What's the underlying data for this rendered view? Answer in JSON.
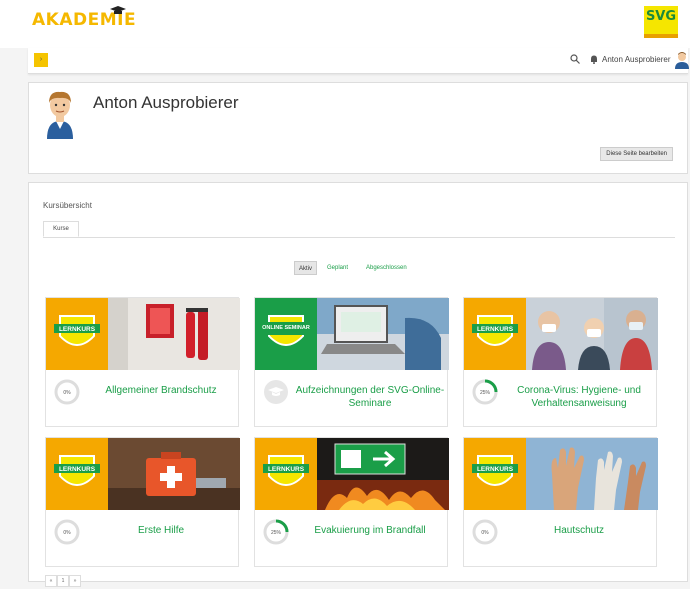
{
  "brand": {
    "left_logo": "AKADEMIE",
    "right_logo": "SVG",
    "colors": {
      "yellow": "#f5b800",
      "green": "#1a9e48"
    }
  },
  "navbar": {
    "toggle_icon": "hamburger-icon",
    "user_name": "Anton Ausprobierer",
    "icons": [
      "search-icon",
      "bell-icon",
      "avatar-icon",
      "caret-down-icon"
    ]
  },
  "profile": {
    "name": "Anton Ausprobierer",
    "edit_button": "Diese Seite bearbeiten"
  },
  "overview": {
    "title": "Kursübersicht",
    "tab": "Kurse",
    "filters": [
      "Aktiv",
      "Geplant",
      "Abgeschlossen"
    ],
    "active_filter": "Aktiv",
    "courses": [
      {
        "title": "Allgemeiner Brandschutz",
        "progress": 0,
        "progress_label": "0%",
        "badge": "LERNKURS"
      },
      {
        "title": "Aufzeichnungen der SVG-Online-Seminare",
        "progress": null,
        "progress_label": "",
        "badge": "ONLINE SEMINAR"
      },
      {
        "title": "Corona-Virus: Hygiene- und Verhaltensanweisung",
        "progress": 25,
        "progress_label": "25%",
        "badge": "LERNKURS"
      },
      {
        "title": "Erste Hilfe",
        "progress": 0,
        "progress_label": "0%",
        "badge": "LERNKURS"
      },
      {
        "title": "Evakuierung im Brandfall",
        "progress": 25,
        "progress_label": "25%",
        "badge": "LERNKURS"
      },
      {
        "title": "Hautschutz",
        "progress": 0,
        "progress_label": "0%",
        "badge": "LERNKURS"
      }
    ],
    "pager": [
      "«",
      "1",
      "»"
    ]
  }
}
